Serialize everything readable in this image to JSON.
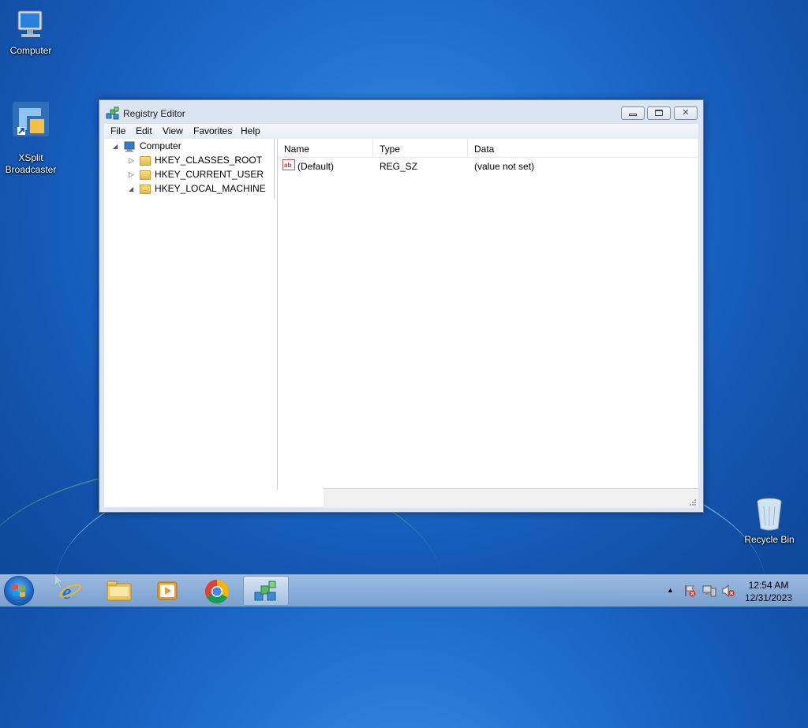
{
  "desktop": {
    "icons": [
      {
        "label": "Computer"
      },
      {
        "label": "XSplit\nBroadcaster"
      },
      {
        "label": "Recycle Bin"
      }
    ]
  },
  "window": {
    "title": "Registry Editor",
    "menu": [
      "File",
      "Edit",
      "View",
      "Favorites",
      "Help"
    ],
    "tree": {
      "root": "Computer",
      "items": [
        "HKEY_CLASSES_ROOT",
        "HKEY_CURRENT_USER",
        "HKEY_LOCAL_MACHINE"
      ]
    },
    "list": {
      "columns": [
        "Name",
        "Type",
        "Data"
      ],
      "rows": [
        {
          "name": "(Default)",
          "type": "REG_SZ",
          "data": "(value not set)"
        }
      ]
    }
  },
  "taskbar": {
    "clock_time": "12:54 AM",
    "clock_date": "12/31/2023"
  }
}
